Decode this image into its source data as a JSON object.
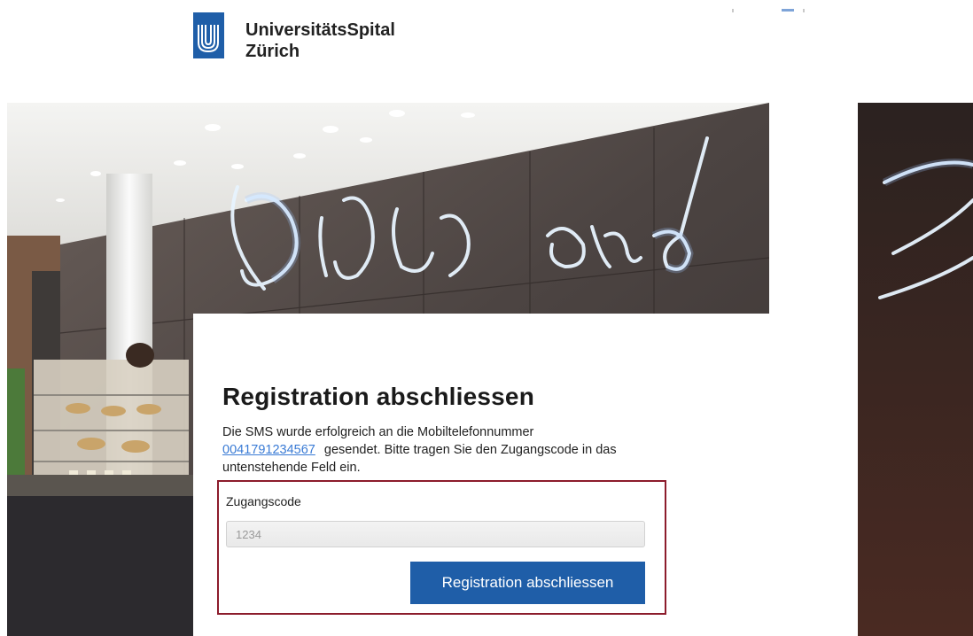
{
  "header": {
    "brand_line1": "UniversitätsSpital",
    "brand_line2": "Zürich",
    "logo_icon": "usz-logo-icon"
  },
  "hero": {
    "sign_text_1": "DICK",
    "sign_text_2": "and"
  },
  "registration": {
    "title": "Registration abschliessen",
    "text_before": "Die SMS wurde erfolgreich an die Mobiltelefonnummer",
    "phone_number": "0041791234567",
    "text_after": "gesendet. Bitte tragen Sie den Zugangscode in das untenstehende Feld ein.",
    "code_label": "Zugangscode",
    "code_placeholder": "1234",
    "submit_label": "Registration abschliessen"
  },
  "colors": {
    "button": "#1f5ea8",
    "form_border": "#8c1c2c",
    "link": "#3a7bd5",
    "logo": "#1f5ea8"
  }
}
